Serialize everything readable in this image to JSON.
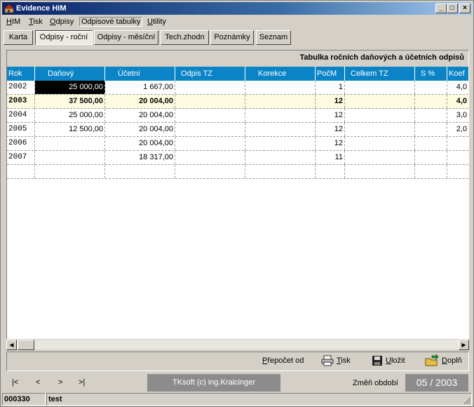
{
  "window": {
    "title": "Evidence HIM",
    "minimize": "_",
    "maximize": "□",
    "close": "×"
  },
  "menu": [
    "HIM",
    "Tisk",
    "Odpisy",
    "Odpisové tabulky",
    "Utility"
  ],
  "tabs": [
    "Karta",
    "Odpisy - roční",
    "Odpisy - měsíční",
    "Tech.zhodn",
    "Poznámky",
    "Seznam"
  ],
  "table": {
    "caption": "Tabulka ročních daňových a účetních odpisů",
    "headers": [
      "Rok",
      "Daňový",
      "Účetní",
      "Odpis TZ",
      "Korekce",
      "PočM",
      "Celkem TZ",
      "S %",
      "Koef"
    ],
    "rows": [
      [
        "2002",
        "25 000,00",
        "1 667,00",
        "",
        "",
        "1",
        "",
        "",
        "4,0"
      ],
      [
        "2003",
        "37 500,00",
        "20 004,00",
        "",
        "",
        "12",
        "",
        "",
        "4,0"
      ],
      [
        "2004",
        "25 000,00",
        "20 004,00",
        "",
        "",
        "12",
        "",
        "",
        "3,0"
      ],
      [
        "2005",
        "12 500,00",
        "20 004,00",
        "",
        "",
        "12",
        "",
        "",
        "2,0"
      ],
      [
        "2006",
        "",
        "20 004,00",
        "",
        "",
        "12",
        "",
        "",
        ""
      ],
      [
        "2007",
        "",
        "18 317,00",
        "",
        "",
        "11",
        "",
        "",
        ""
      ],
      [
        "",
        "",
        "",
        "",
        "",
        "",
        "",
        "",
        ""
      ]
    ]
  },
  "actions": {
    "recalc": "Přepočet od",
    "print": "Tisk",
    "save": "Uložit",
    "fill": "Doplň"
  },
  "nav": {
    "first": "|<",
    "prev": "<",
    "next": ">",
    "last": ">|"
  },
  "footer": {
    "copyright": "TKsoft (c) ing.Kraicinger",
    "period_label": "Změň období",
    "period": "05 / 2003"
  },
  "status": {
    "record": "000330",
    "user": "test"
  }
}
